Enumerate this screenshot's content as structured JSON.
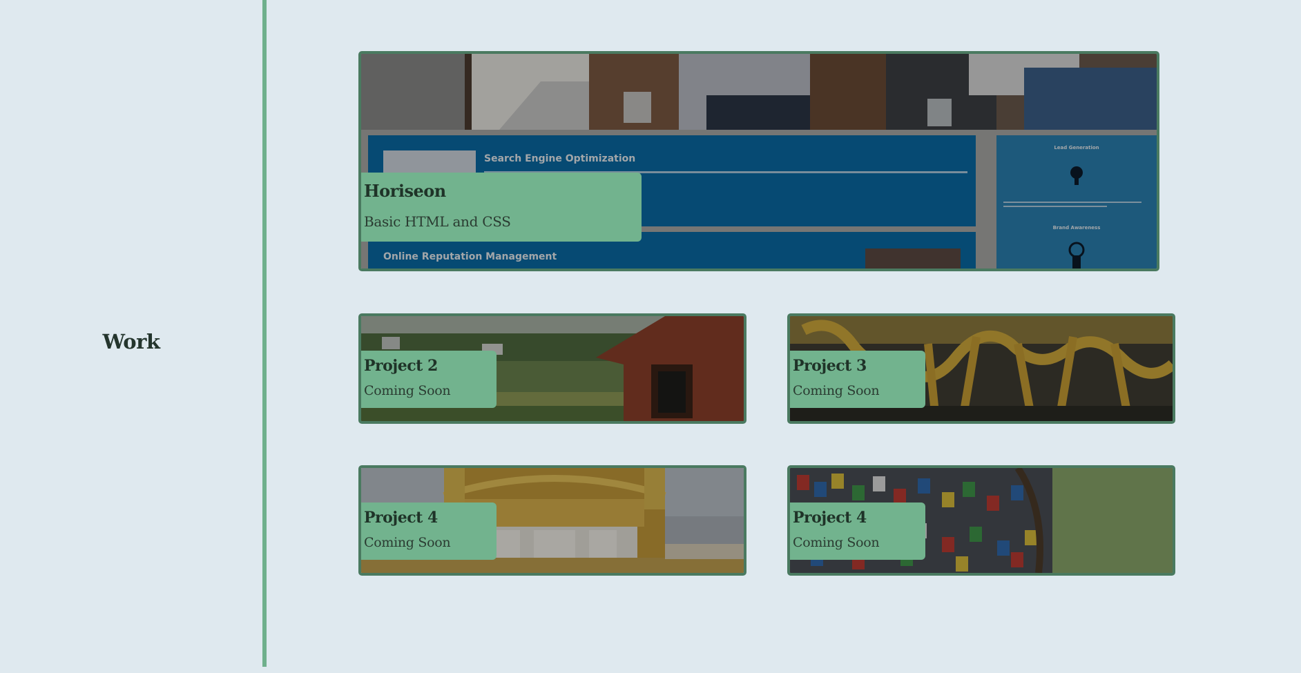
{
  "section": {
    "label": "Work"
  },
  "projects": [
    {
      "id": "horiseon",
      "title": "Horiseon",
      "subtitle": "Basic HTML and CSS",
      "thumbnail": {
        "heading_1": "Search Engine Optimization",
        "heading_2": "Online Reputation Management",
        "sidebar_1": "Lead Generation",
        "sidebar_2": "Brand Awareness"
      }
    },
    {
      "id": "project-2",
      "title": "Project 2",
      "subtitle": "Coming Soon"
    },
    {
      "id": "project-3",
      "title": "Project 3",
      "subtitle": "Coming Soon"
    },
    {
      "id": "project-4a",
      "title": "Project 4",
      "subtitle": "Coming Soon"
    },
    {
      "id": "project-4b",
      "title": "Project 4",
      "subtitle": "Coming Soon"
    }
  ],
  "colors": {
    "background": "#dfe9ef",
    "accent": "#6fb08c",
    "card_border": "#4a7a60",
    "caption_bg": "#72b38e",
    "text_dark": "#24352d"
  }
}
